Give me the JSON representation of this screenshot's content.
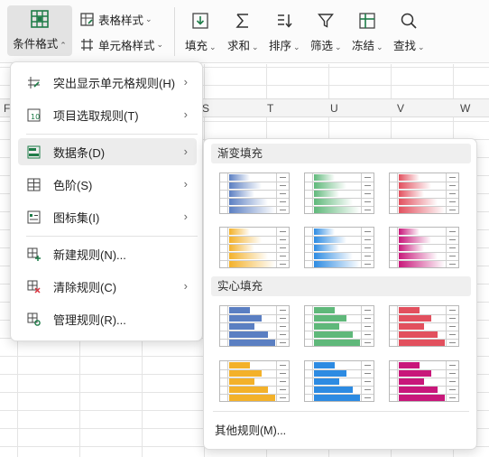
{
  "ribbon": {
    "conditional_format": "条件格式",
    "table_style": "表格样式",
    "cell_style": "单元格样式",
    "fill": "填充",
    "sum": "求和",
    "sort": "排序",
    "filter": "筛选",
    "freeze": "冻结",
    "find": "查找",
    "accent": "#1e7c48"
  },
  "columns": [
    "F",
    "S",
    "T",
    "U",
    "V",
    "W"
  ],
  "menu": {
    "items": [
      {
        "label": "突出显示单元格规则(H)",
        "icon": "highlight-rules-icon",
        "submenu": true
      },
      {
        "label": "项目选取规则(T)",
        "icon": "top-bottom-rules-icon",
        "submenu": true
      },
      {
        "label": "数据条(D)",
        "icon": "data-bars-icon",
        "submenu": true,
        "active": true
      },
      {
        "label": "色阶(S)",
        "icon": "color-scales-icon",
        "submenu": true
      },
      {
        "label": "图标集(I)",
        "icon": "icon-sets-icon",
        "submenu": true
      },
      {
        "label": "新建规则(N)...",
        "icon": "new-rule-icon",
        "submenu": false
      },
      {
        "label": "清除规则(C)",
        "icon": "clear-rules-icon",
        "submenu": true
      },
      {
        "label": "管理规则(R)...",
        "icon": "manage-rules-icon",
        "submenu": false
      }
    ]
  },
  "databars": {
    "gradient_title": "渐变填充",
    "solid_title": "实心填充",
    "more": "其他规则(M)...",
    "colors": [
      "#5b7fc2",
      "#5fb87a",
      "#e2505e",
      "#f3b12a",
      "#2d8be2",
      "#c8177a"
    ],
    "bar_levels": [
      0.45,
      0.7,
      0.55,
      0.85,
      1.0
    ]
  }
}
